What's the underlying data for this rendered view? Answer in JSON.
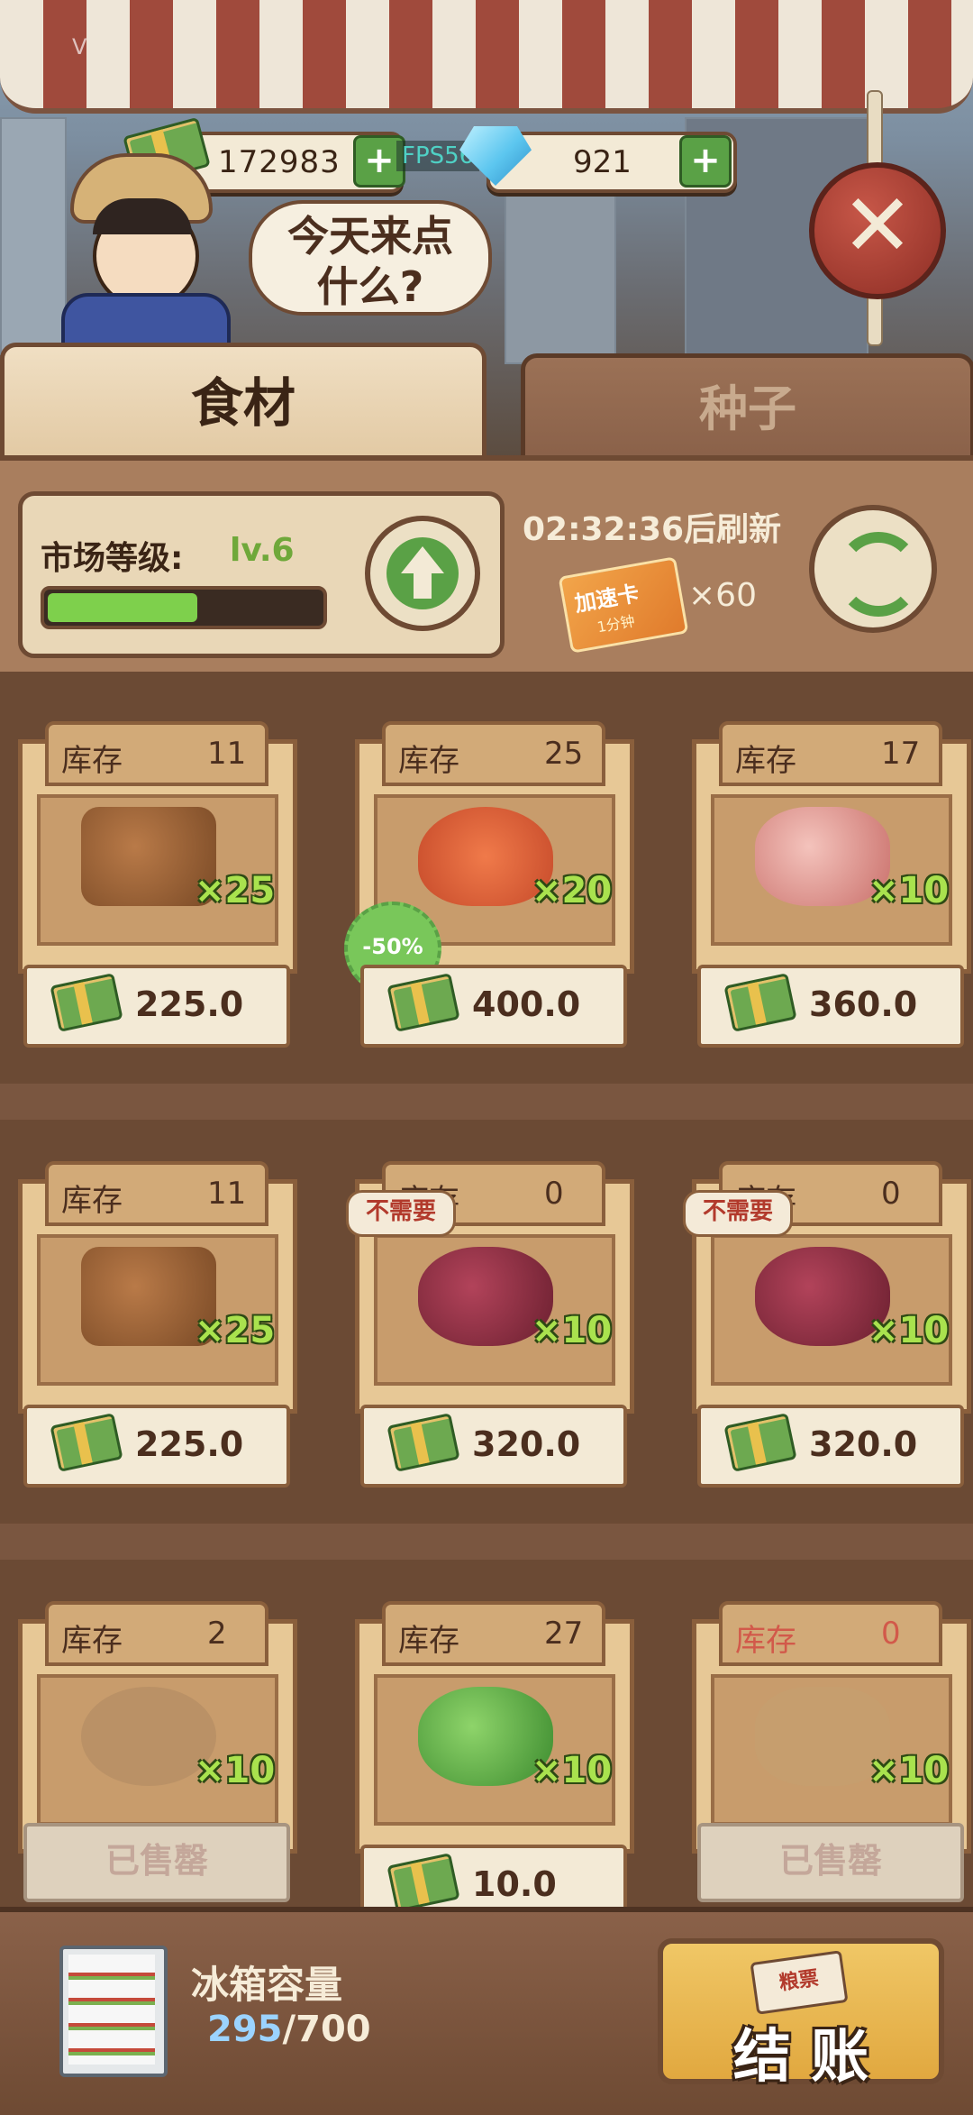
{
  "currency": {
    "cash": "172983",
    "gems": "921",
    "plus": "+",
    "fps": "FPS56"
  },
  "version_text": "V",
  "npc": {
    "speech_line1": "今天来点",
    "speech_line2": "什么?"
  },
  "close_symbol": "✕",
  "tabs": [
    {
      "label": "食材"
    },
    {
      "label": "种子"
    }
  ],
  "market": {
    "level_label": "市场等级:",
    "level_value": "lv.6",
    "level_progress": 0.55,
    "refresh_text": "02:32:36后刷新",
    "speed_card_label": "加速卡",
    "speed_card_sub": "1分钟",
    "speed_card_count": "×60"
  },
  "items": [
    {
      "stock_label": "库存",
      "stock": "11",
      "qty": "×25",
      "price": "225.0",
      "icon": "spice-icon",
      "state": "normal"
    },
    {
      "stock_label": "库存",
      "stock": "25",
      "qty": "×20",
      "price": "400.0",
      "icon": "shrimp-icon",
      "state": "normal",
      "discount": "-50%"
    },
    {
      "stock_label": "库存",
      "stock": "17",
      "qty": "×10",
      "price": "360.0",
      "icon": "meat-icon",
      "state": "normal"
    },
    {
      "stock_label": "库存",
      "stock": "11",
      "qty": "×25",
      "price": "225.0",
      "icon": "spice-icon",
      "state": "normal"
    },
    {
      "stock_label": "库存",
      "stock": "0",
      "qty": "×10",
      "price": "320.0",
      "icon": "liver-icon",
      "state": "normal",
      "tag": "不需要"
    },
    {
      "stock_label": "库存",
      "stock": "0",
      "qty": "×10",
      "price": "320.0",
      "icon": "liver-icon",
      "state": "normal",
      "tag": "不需要"
    },
    {
      "stock_label": "库存",
      "stock": "2",
      "qty": "×10",
      "price": "已售罄",
      "icon": "fish-icon",
      "state": "soldout"
    },
    {
      "stock_label": "库存",
      "stock": "27",
      "qty": "×10",
      "price": "10.0",
      "icon": "cabbage-icon",
      "state": "normal"
    },
    {
      "stock_label": "库存",
      "stock": "0",
      "qty": "×10",
      "price": "已售罄",
      "icon": "ginger-icon",
      "state": "soldout_red"
    }
  ],
  "fridge": {
    "label": "冰箱容量",
    "used": "295",
    "total": "/700"
  },
  "checkout": {
    "label": "结 账",
    "ticket_label": "粮票"
  },
  "colors": {
    "accent_green": "#5aa146",
    "wood": "#6e4a33",
    "sold_red": "#d2594a"
  }
}
